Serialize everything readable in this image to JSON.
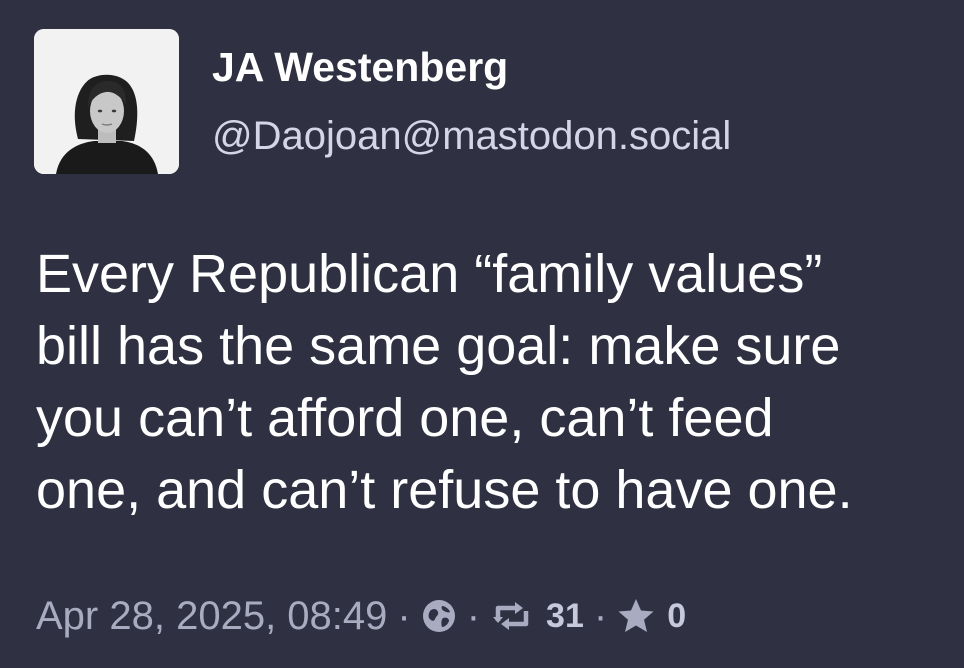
{
  "author": {
    "display_name": "JA Westenberg",
    "handle": "@Daojoan@mastodon.social"
  },
  "post": {
    "content_lines": [
      "Every Republican “family values”",
      "bill has the same goal: make sure",
      "you can’t afford one, can’t feed",
      "one, and can’t refuse to have one."
    ]
  },
  "meta": {
    "timestamp": "Apr 28, 2025, 08:49",
    "separator": "·",
    "visibility_icon": "globe-icon",
    "boosts": "31",
    "favourites": "0"
  },
  "colors": {
    "background": "#2f3142",
    "text": "#ffffff",
    "muted": "#a9abc0"
  }
}
